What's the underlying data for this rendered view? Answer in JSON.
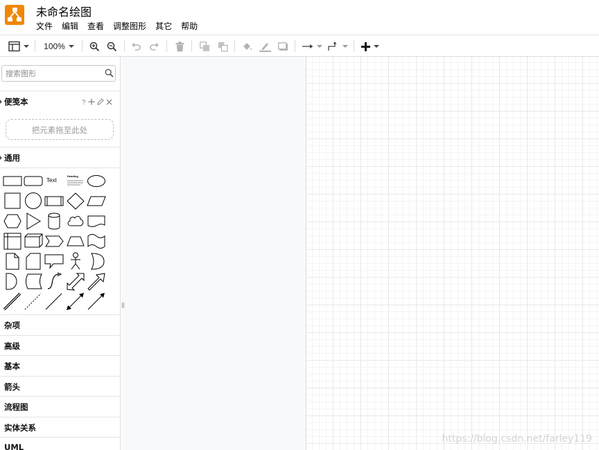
{
  "app": {
    "title": "未命名绘图",
    "logo_icon": "drawio-logo-icon",
    "brand_color": "#f08705"
  },
  "menu": [
    "文件",
    "编辑",
    "查看",
    "调整图形",
    "其它",
    "帮助"
  ],
  "toolbar": {
    "zoom": "100%",
    "icons": [
      "format-panel-icon",
      "zoom-in-icon",
      "zoom-out-icon",
      "undo-icon",
      "redo-icon",
      "delete-icon",
      "to-front-icon",
      "to-back-icon",
      "fill-color-icon",
      "line-color-icon",
      "shadow-icon",
      "connection-arrow-icon",
      "waypoints-icon",
      "insert-plus-icon"
    ]
  },
  "sidebar": {
    "search_placeholder": "搜索图形",
    "scratchpad": {
      "label": "便笺本",
      "help": "?",
      "drop_hint": "把元素拖至此处"
    },
    "general": {
      "label": "通用",
      "text_shape": "Text",
      "heading_shape": "Heading"
    },
    "collapsed_sections": [
      "杂项",
      "高级",
      "基本",
      "箭头",
      "流程图",
      "实体关系",
      "UML"
    ]
  },
  "canvas": {
    "watermark": "https://blog.csdn.net/farley119",
    "grid": true
  }
}
